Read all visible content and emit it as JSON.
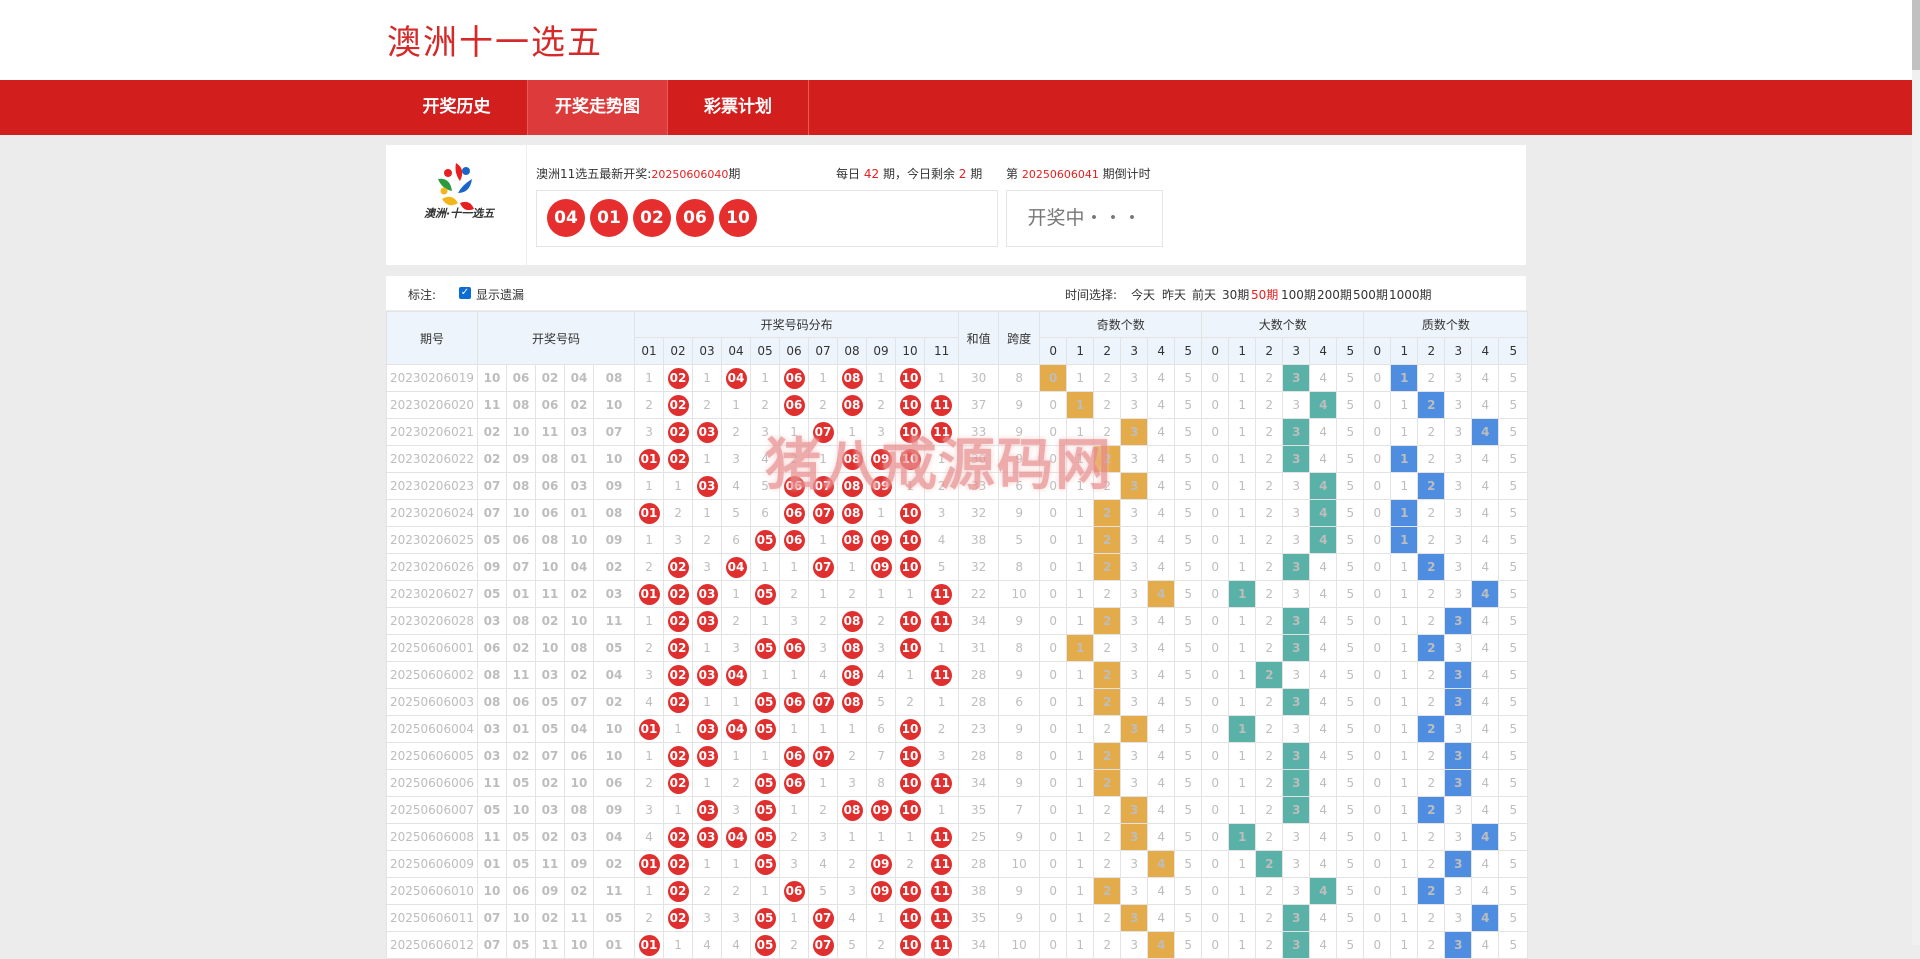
{
  "site": {
    "title": "澳洲十一选五"
  },
  "nav": [
    "开奖历史",
    "开奖走势图",
    "彩票计划"
  ],
  "logo_text": "澳洲·十一选五",
  "latest": {
    "label": "澳洲11选五最新开奖:",
    "period": "20250606040",
    "period_suffix": "期",
    "balls": [
      "04",
      "01",
      "02",
      "06",
      "10"
    ]
  },
  "daily": {
    "prefix": "每日",
    "count": "42",
    "mid": "期，今日剩余",
    "remaining": "2",
    "suffix": "期"
  },
  "next": {
    "prefix": "第",
    "period": "20250606041",
    "suffix": "期倒计时"
  },
  "drawing_text": "开奖中・・・",
  "filter": {
    "label": "标注:",
    "show_missing": "显示遗漏",
    "time_label": "时间选择:",
    "time_options": [
      "今天",
      "昨天",
      "前天",
      "30期",
      "50期",
      "100期",
      "200期",
      "500期",
      "1000期"
    ],
    "active_time": "50期"
  },
  "table": {
    "headers": {
      "period": "期号",
      "numbers": "开奖号码",
      "distribution": "开奖号码分布",
      "sum": "和值",
      "span": "跨度",
      "odd": "奇数个数",
      "big": "大数个数",
      "prime": "质数个数"
    },
    "dist_cols": [
      "01",
      "02",
      "03",
      "04",
      "05",
      "06",
      "07",
      "08",
      "09",
      "10",
      "11"
    ],
    "count_cols": [
      "0",
      "1",
      "2",
      "3",
      "4",
      "5"
    ],
    "rows": [
      {
        "period": "20230206019",
        "nums": [
          "10",
          "06",
          "02",
          "04",
          "08"
        ],
        "sum": "30",
        "span": "8",
        "odd": 0,
        "big": 3,
        "prime": 1
      },
      {
        "period": "20230206020",
        "nums": [
          "11",
          "08",
          "06",
          "02",
          "10"
        ],
        "sum": "37",
        "span": "9",
        "odd": 1,
        "big": 4,
        "prime": 2
      },
      {
        "period": "20230206021",
        "nums": [
          "02",
          "10",
          "11",
          "03",
          "07"
        ],
        "sum": "33",
        "span": "9",
        "odd": 3,
        "big": 3,
        "prime": 4
      },
      {
        "period": "20230206022",
        "nums": [
          "02",
          "09",
          "08",
          "01",
          "10"
        ],
        "sum": "30",
        "span": "9",
        "odd": 2,
        "big": 3,
        "prime": 1
      },
      {
        "period": "20230206023",
        "nums": [
          "07",
          "08",
          "06",
          "03",
          "09"
        ],
        "sum": "33",
        "span": "6",
        "odd": 3,
        "big": 4,
        "prime": 2
      },
      {
        "period": "20230206024",
        "nums": [
          "07",
          "10",
          "06",
          "01",
          "08"
        ],
        "sum": "32",
        "span": "9",
        "odd": 2,
        "big": 4,
        "prime": 1
      },
      {
        "period": "20230206025",
        "nums": [
          "05",
          "06",
          "08",
          "10",
          "09"
        ],
        "sum": "38",
        "span": "5",
        "odd": 2,
        "big": 4,
        "prime": 1
      },
      {
        "period": "20230206026",
        "nums": [
          "09",
          "07",
          "10",
          "04",
          "02"
        ],
        "sum": "32",
        "span": "8",
        "odd": 2,
        "big": 3,
        "prime": 2
      },
      {
        "period": "20230206027",
        "nums": [
          "05",
          "01",
          "11",
          "02",
          "03"
        ],
        "sum": "22",
        "span": "10",
        "odd": 4,
        "big": 1,
        "prime": 4
      },
      {
        "period": "20230206028",
        "nums": [
          "03",
          "08",
          "02",
          "10",
          "11"
        ],
        "sum": "34",
        "span": "9",
        "odd": 2,
        "big": 3,
        "prime": 3
      },
      {
        "period": "20250606001",
        "nums": [
          "06",
          "02",
          "10",
          "08",
          "05"
        ],
        "sum": "31",
        "span": "8",
        "odd": 1,
        "big": 3,
        "prime": 2
      },
      {
        "period": "20250606002",
        "nums": [
          "08",
          "11",
          "03",
          "02",
          "04"
        ],
        "sum": "28",
        "span": "9",
        "odd": 2,
        "big": 2,
        "prime": 3
      },
      {
        "period": "20250606003",
        "nums": [
          "08",
          "06",
          "05",
          "07",
          "02"
        ],
        "sum": "28",
        "span": "6",
        "odd": 2,
        "big": 3,
        "prime": 3
      },
      {
        "period": "20250606004",
        "nums": [
          "03",
          "01",
          "05",
          "04",
          "10"
        ],
        "sum": "23",
        "span": "9",
        "odd": 3,
        "big": 1,
        "prime": 2
      },
      {
        "period": "20250606005",
        "nums": [
          "03",
          "02",
          "07",
          "06",
          "10"
        ],
        "sum": "28",
        "span": "8",
        "odd": 2,
        "big": 3,
        "prime": 3
      },
      {
        "period": "20250606006",
        "nums": [
          "11",
          "05",
          "02",
          "10",
          "06"
        ],
        "sum": "34",
        "span": "9",
        "odd": 2,
        "big": 3,
        "prime": 3
      },
      {
        "period": "20250606007",
        "nums": [
          "05",
          "10",
          "03",
          "08",
          "09"
        ],
        "sum": "35",
        "span": "7",
        "odd": 3,
        "big": 3,
        "prime": 2
      },
      {
        "period": "20250606008",
        "nums": [
          "11",
          "05",
          "02",
          "03",
          "04"
        ],
        "sum": "25",
        "span": "9",
        "odd": 3,
        "big": 1,
        "prime": 4
      },
      {
        "period": "20250606009",
        "nums": [
          "01",
          "05",
          "11",
          "09",
          "02"
        ],
        "sum": "28",
        "span": "10",
        "odd": 4,
        "big": 2,
        "prime": 3
      },
      {
        "period": "20250606010",
        "nums": [
          "10",
          "06",
          "09",
          "02",
          "11"
        ],
        "sum": "38",
        "span": "9",
        "odd": 2,
        "big": 4,
        "prime": 2
      },
      {
        "period": "20250606011",
        "nums": [
          "07",
          "10",
          "02",
          "11",
          "05"
        ],
        "sum": "35",
        "span": "9",
        "odd": 3,
        "big": 3,
        "prime": 4
      },
      {
        "period": "20250606012",
        "nums": [
          "07",
          "05",
          "11",
          "10",
          "01"
        ],
        "sum": "34",
        "span": "10",
        "odd": 4,
        "big": 3,
        "prime": 3
      }
    ]
  },
  "watermark": "猪八戒源码网",
  "colors": {
    "brand_red": "#d31e1e",
    "ball_red": "#e62e2e",
    "odd": "#e3ab4a",
    "big": "#5ab1a7",
    "prime": "#4e8de0"
  }
}
